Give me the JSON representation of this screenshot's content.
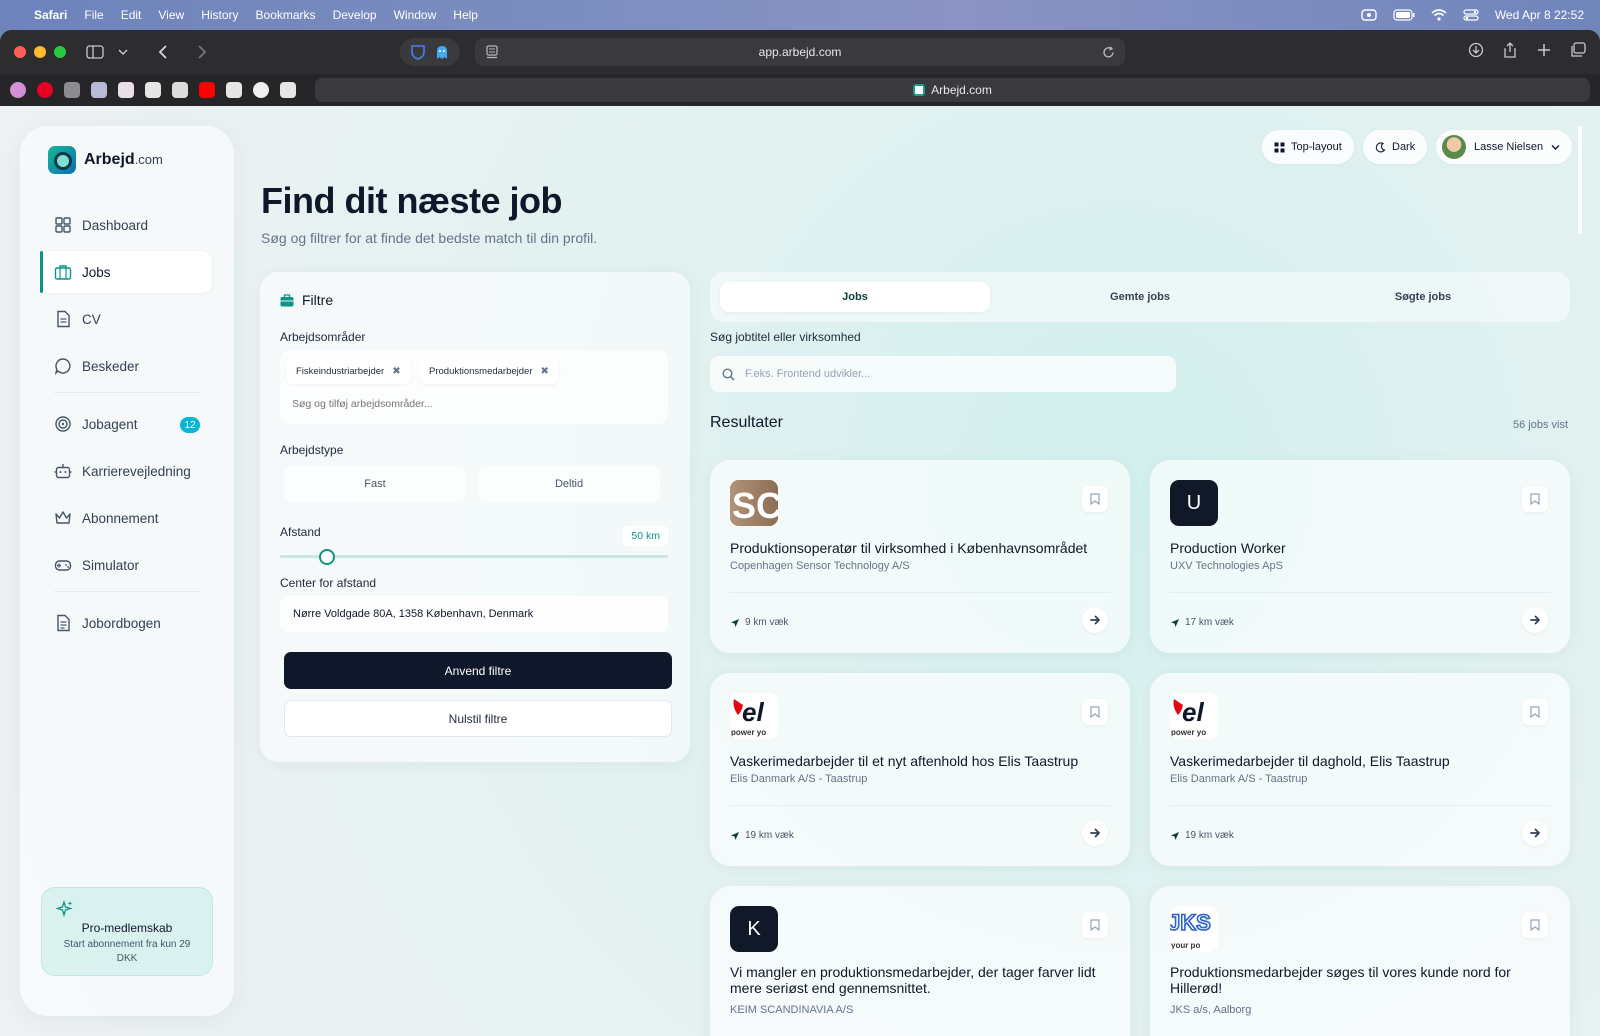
{
  "menubar": {
    "app": "Safari",
    "items": [
      "File",
      "Edit",
      "View",
      "History",
      "Bookmarks",
      "Develop",
      "Window",
      "Help"
    ],
    "datetime": "Wed Apr 8  22:52"
  },
  "browser": {
    "url": "app.arbejd.com",
    "tab_title": "Arbejd.com"
  },
  "sidebar": {
    "logo": {
      "name": "Arbejd",
      "suffix": ".com"
    },
    "items": [
      {
        "label": "Dashboard",
        "icon": "grid-icon"
      },
      {
        "label": "Jobs",
        "icon": "briefcase-icon",
        "active": true
      },
      {
        "label": "CV",
        "icon": "document-icon"
      },
      {
        "label": "Beskeder",
        "icon": "chat-icon"
      },
      {
        "label": "Jobagent",
        "icon": "target-icon",
        "badge": "12"
      },
      {
        "label": "Karrierevejledning",
        "icon": "robot-icon"
      },
      {
        "label": "Abonnement",
        "icon": "crown-icon"
      },
      {
        "label": "Simulator",
        "icon": "gamepad-icon"
      },
      {
        "label": "Jobordbogen",
        "icon": "book-icon"
      }
    ],
    "pro": {
      "title": "Pro-medlemskab",
      "subtitle": "Start abonnement fra kun 29 DKK"
    }
  },
  "topbar": {
    "layout_label": "Top-layout",
    "theme_label": "Dark",
    "user_name": "Lasse Nielsen"
  },
  "header": {
    "title": "Find dit næste job",
    "subtitle": "Søg og filtrer for at finde det bedste match til din profil."
  },
  "filters": {
    "title": "Filtre",
    "areas_label": "Arbejdsområder",
    "area_tags": [
      "Fiskeindustriarbejder",
      "Produktionsmedarbejder"
    ],
    "area_placeholder": "Søg og tilføj arbejdsområder...",
    "type_label": "Arbejdstype",
    "type_options": [
      "Fast",
      "Deltid"
    ],
    "distance_label": "Afstand",
    "distance_value": "50 km",
    "distance_fraction": 0.12,
    "center_label": "Center for afstand",
    "center_value": "Nørre Voldgade 80A, 1358 København, Denmark",
    "apply_label": "Anvend filtre",
    "reset_label": "Nulstil filtre"
  },
  "tabs": [
    "Jobs",
    "Gemte jobs",
    "Søgte jobs"
  ],
  "search": {
    "label": "Søg jobtitel eller virksomhed",
    "placeholder": "F.eks. Frontend udvikler..."
  },
  "results": {
    "title": "Resultater",
    "count": "56 jobs vist",
    "jobs": [
      {
        "title": "Produktionsoperatør til virksomhed i Københavnsområdet",
        "company": "Copenhagen Sensor Technology A/S",
        "distance": "9 km væk",
        "logo": "SC"
      },
      {
        "title": "Production Worker",
        "company": "UXV Technologies ApS",
        "distance": "17 km væk",
        "logo": "U"
      },
      {
        "title": "Vaskerimedarbejder til et nyt aftenhold hos Elis Taastrup",
        "company": "Elis Danmark A/S - Taastrup",
        "distance": "19 km væk",
        "logo": "el",
        "logo_sub": "power yo"
      },
      {
        "title": "Vaskerimedarbejder til daghold, Elis Taastrup",
        "company": "Elis Danmark A/S - Taastrup",
        "distance": "19 km væk",
        "logo": "el",
        "logo_sub": "power yo"
      },
      {
        "title": "Vi mangler en produktionsmedarbejder, der tager farver lidt mere seriøst end gennemsnittet.",
        "company": "KEIM SCANDINAVIA A/S",
        "logo": "K"
      },
      {
        "title": "Produktionsmedarbejder søges til vores kunde nord for Hillerød!",
        "company": "JKS a/s, Aalborg",
        "logo": "JKS",
        "logo_sub": "your po"
      }
    ]
  },
  "colors": {
    "accent": "#0d9488",
    "dark": "#0f172a",
    "badge": "#06b6d4"
  }
}
